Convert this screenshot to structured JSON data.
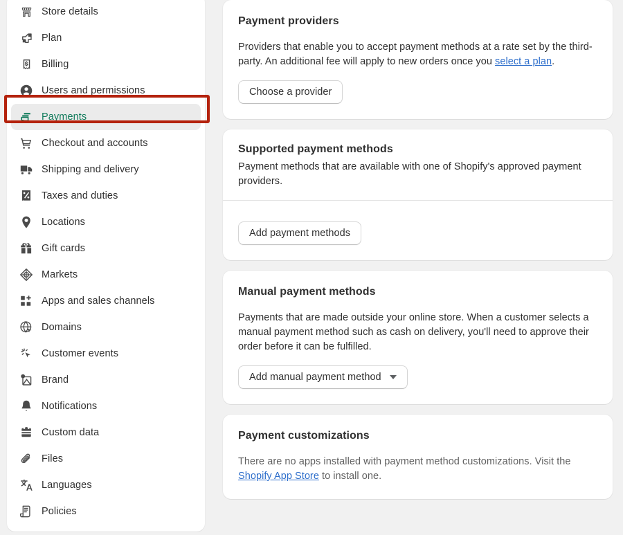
{
  "sidebar": {
    "items": [
      {
        "label": "Store details",
        "icon": "store-icon",
        "active": false
      },
      {
        "label": "Plan",
        "icon": "plan-icon",
        "active": false
      },
      {
        "label": "Billing",
        "icon": "billing-icon",
        "active": false
      },
      {
        "label": "Users and permissions",
        "icon": "user-icon",
        "active": false
      },
      {
        "label": "Payments",
        "icon": "payments-icon",
        "active": true
      },
      {
        "label": "Checkout and accounts",
        "icon": "cart-icon",
        "active": false
      },
      {
        "label": "Shipping and delivery",
        "icon": "truck-icon",
        "active": false
      },
      {
        "label": "Taxes and duties",
        "icon": "tax-icon",
        "active": false
      },
      {
        "label": "Locations",
        "icon": "location-pin-icon",
        "active": false
      },
      {
        "label": "Gift cards",
        "icon": "gift-icon",
        "active": false
      },
      {
        "label": "Markets",
        "icon": "markets-icon",
        "active": false
      },
      {
        "label": "Apps and sales channels",
        "icon": "apps-icon",
        "active": false
      },
      {
        "label": "Domains",
        "icon": "domain-globe-icon",
        "active": false
      },
      {
        "label": "Customer events",
        "icon": "customer-events-icon",
        "active": false
      },
      {
        "label": "Brand",
        "icon": "brand-image-icon",
        "active": false
      },
      {
        "label": "Notifications",
        "icon": "bell-icon",
        "active": false
      },
      {
        "label": "Custom data",
        "icon": "custom-data-icon",
        "active": false
      },
      {
        "label": "Files",
        "icon": "paperclip-icon",
        "active": false
      },
      {
        "label": "Languages",
        "icon": "languages-icon",
        "active": false
      },
      {
        "label": "Policies",
        "icon": "policies-icon",
        "active": false
      }
    ]
  },
  "annotation": {
    "target": "Payments",
    "color": "#b4220c"
  },
  "colors": {
    "accent_green": "#0f7a5a",
    "link_blue": "#2d6ecb",
    "highlight_red": "#b4220c",
    "page_bg": "#f1f1f1",
    "card_bg": "#ffffff"
  },
  "main": {
    "payment_providers": {
      "title": "Payment providers",
      "body_before_link": "Providers that enable you to accept payment methods at a rate set by the third-party. An additional fee will apply to new orders once you ",
      "link_label": "select a plan",
      "body_after_link": ".",
      "button_label": "Choose a provider"
    },
    "supported_payment_methods": {
      "title": "Supported payment methods",
      "body": "Payment methods that are available with one of Shopify's approved payment providers.",
      "button_label": "Add payment methods"
    },
    "manual_payment_methods": {
      "title": "Manual payment methods",
      "body": "Payments that are made outside your online store. When a customer selects a manual payment method such as cash on delivery, you'll need to approve their order before it can be fulfilled.",
      "button_label": "Add manual payment method",
      "button_caret": "chevron-down-icon"
    },
    "payment_customizations": {
      "title": "Payment customizations",
      "body_before_link": "There are no apps installed with payment method customizations. Visit the ",
      "link_label": "Shopify App Store",
      "body_after_link": " to install one."
    }
  }
}
